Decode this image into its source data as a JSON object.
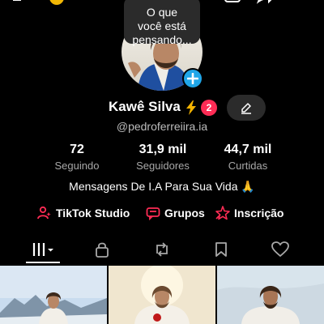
{
  "profile": {
    "thought_bubble": "O que\nvocê está\npensando...",
    "display_name": "Kawê Silva",
    "notification_count": "2",
    "username": "@pedroferreiira.ia",
    "bio": "Mensagens De I.A Para Sua Vida 🙏"
  },
  "stats": {
    "following": {
      "value": "72",
      "label": "Seguindo"
    },
    "followers": {
      "value": "31,9 mil",
      "label": "Seguidores"
    },
    "likes": {
      "value": "44,7 mil",
      "label": "Curtidas"
    }
  },
  "links": {
    "studio": "TikTok Studio",
    "groups": "Grupos",
    "subscription": "Inscrição"
  },
  "icons": {
    "add_friend": "add-friend-icon",
    "emoji": "emoji-face-icon",
    "qr": "qr-code-icon",
    "share": "share-icon",
    "menu": "menu-icon",
    "plus": "plus-icon",
    "bolt": "bolt-icon",
    "edit": "pencil-icon",
    "studio": "studio-person-icon",
    "groups": "groups-chat-icon",
    "subscription": "subscription-star-icon",
    "tab_grid": "grid-icon",
    "tab_lock": "lock-icon",
    "tab_repost": "repost-icon",
    "tab_saved": "bookmark-icon",
    "tab_liked": "heart-icon"
  },
  "colors": {
    "accent_red": "#fe2c55",
    "add_blue": "#20a6e8",
    "bolt_yellow": "#f5b400",
    "secondary_text": "#a8a8a8",
    "button_bg": "#2b2b2b"
  }
}
